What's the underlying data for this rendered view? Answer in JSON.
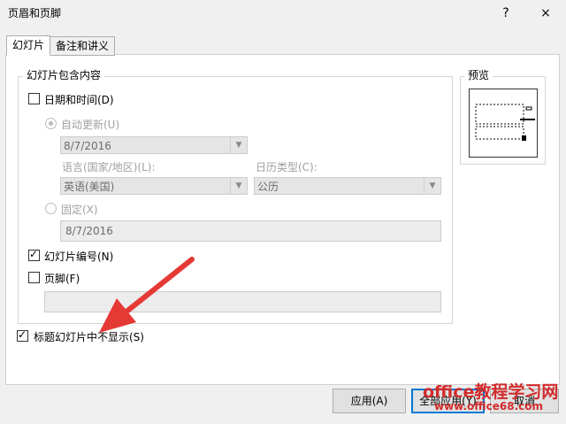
{
  "window": {
    "title": "页眉和页脚",
    "help_label": "?",
    "close_label": "×"
  },
  "tabs": [
    {
      "label": "幻灯片",
      "active": true
    },
    {
      "label": "备注和讲义",
      "active": false
    }
  ],
  "group": {
    "title": "幻灯片包含内容",
    "date_time": {
      "label": "日期和时间(D)",
      "checked": false
    },
    "auto_update": {
      "label": "自动更新(U)",
      "selected": true,
      "disabled": true
    },
    "date_format_select": {
      "value": "8/7/2016"
    },
    "language_label": "语言(国家/地区)(L):",
    "language_select": {
      "value": "英语(美国)"
    },
    "calendar_label": "日历类型(C):",
    "calendar_select": {
      "value": "公历"
    },
    "fixed": {
      "label": "固定(X)",
      "selected": false,
      "disabled": true
    },
    "fixed_input": {
      "value": "8/7/2016"
    },
    "slide_number": {
      "label": "幻灯片编号(N)",
      "checked": true
    },
    "footer": {
      "label": "页脚(F)",
      "checked": false
    },
    "footer_input": {
      "value": ""
    }
  },
  "hide_on_title": {
    "label": "标题幻灯片中不显示(S)",
    "checked": true
  },
  "preview": {
    "title": "预览"
  },
  "buttons": {
    "apply": "应用(A)",
    "apply_all": "全部应用(Y)",
    "cancel": "取消"
  },
  "watermark": {
    "line1": "office教程学习网",
    "line2": "www.office68.com"
  },
  "colors": {
    "accent": "#0078d7",
    "arrow": "#e53935",
    "watermark": "#d22c2c"
  }
}
